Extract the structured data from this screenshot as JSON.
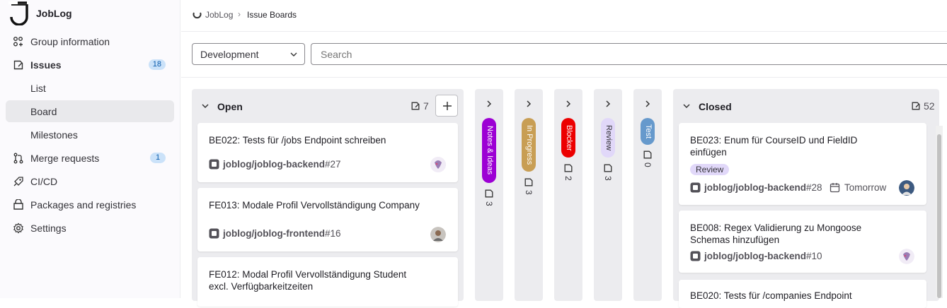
{
  "app": {
    "name": "JobLog"
  },
  "sidebar": {
    "items": [
      {
        "label": "Group information",
        "icon": "group-icon"
      },
      {
        "label": "Issues",
        "icon": "issues-icon",
        "badge": "18"
      },
      {
        "label": "List"
      },
      {
        "label": "Board",
        "active": true
      },
      {
        "label": "Milestones"
      },
      {
        "label": "Merge requests",
        "icon": "merge-request-icon",
        "badge": "1"
      },
      {
        "label": "CI/CD",
        "icon": "rocket-icon"
      },
      {
        "label": "Packages and registries",
        "icon": "package-icon"
      },
      {
        "label": "Settings",
        "icon": "gear-icon"
      }
    ]
  },
  "breadcrumb": {
    "root": "JobLog",
    "separator": "›",
    "current": "Issue Boards"
  },
  "filters": {
    "board_select": "Development",
    "search_placeholder": "Search"
  },
  "lists": {
    "open": {
      "title": "Open",
      "count": "7",
      "cards": [
        {
          "title": "BE022: Tests für /jobs Endpoint schreiben",
          "project": "joblog/joblog-backend",
          "number": "#27"
        },
        {
          "title": "FE013: Modale Profil Vervollständigung Company",
          "project": "joblog/joblog-frontend",
          "number": "#16"
        },
        {
          "title": "FE012: Modal Profil Vervollständigung Student excl. Verfügbarkeitzeiten",
          "project": "",
          "number": ""
        }
      ]
    },
    "collapsed": [
      {
        "label": "Notes & Ideas",
        "count": "3",
        "color": "#9c00d4"
      },
      {
        "label": "In Progress",
        "count": "3",
        "color": "#c89e54"
      },
      {
        "label": "Blocker",
        "count": "2",
        "color": "#ec0000"
      },
      {
        "label": "Review",
        "count": "3",
        "color": "#e1d8f9"
      },
      {
        "label": "Test",
        "count": "0",
        "color": "#6699cc"
      }
    ],
    "closed": {
      "title": "Closed",
      "count": "52",
      "cards": [
        {
          "title": "BE023: Enum für CourseID und FieldID einfügen",
          "label": "Review",
          "project": "joblog/joblog-backend",
          "number": "#28",
          "due": "Tomorrow"
        },
        {
          "title": "BE008: Regex Validierung zu Mongoose Schemas hinzufügen",
          "project": "joblog/joblog-backend",
          "number": "#10"
        },
        {
          "title": "BE020: Tests für /companies Endpoint"
        }
      ]
    }
  }
}
